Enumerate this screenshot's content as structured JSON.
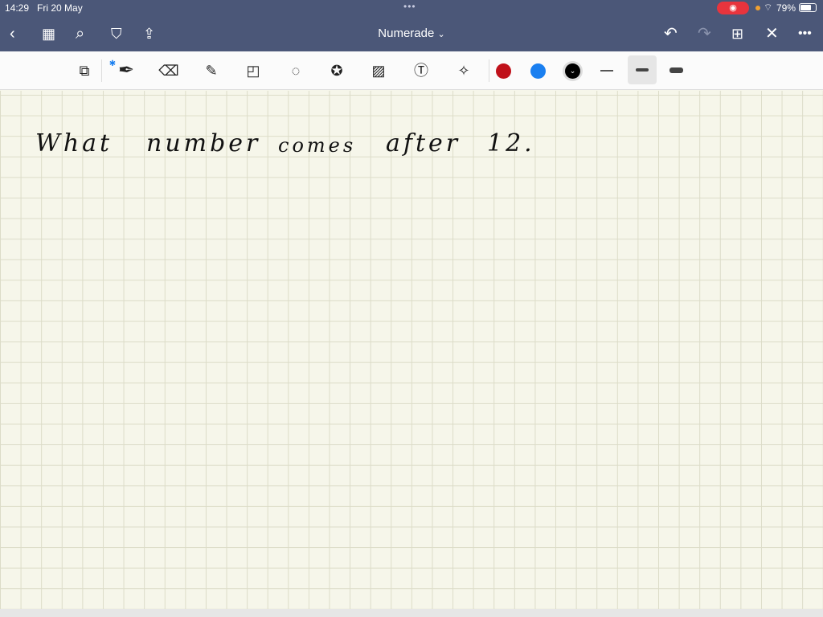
{
  "status": {
    "time": "14:29",
    "date": "Fri 20 May",
    "battery": "79%",
    "battery_level": 0.79
  },
  "nav": {
    "title": "Numerade",
    "title_chevron": "⌄"
  },
  "toolbar": {
    "colors": [
      "#c0111a",
      "#1a7ff0",
      "#000000"
    ]
  },
  "note": {
    "words": [
      "What",
      "number",
      "comes",
      "after",
      "12."
    ]
  }
}
